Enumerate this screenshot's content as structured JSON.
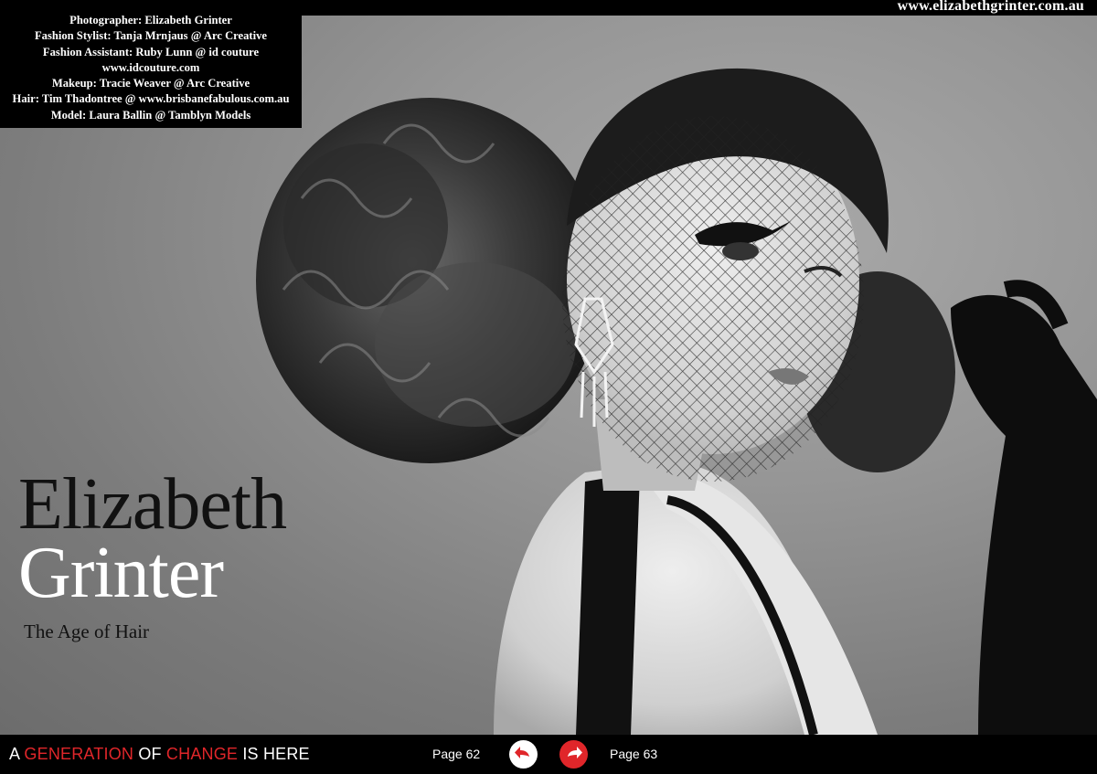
{
  "header": {
    "url": "www.elizabethgrinter.com.au"
  },
  "credits": [
    "Photographer: Elizabeth Grinter",
    "Fashion Stylist: Tanja Mrnjaus @ Arc Creative",
    "Fashion Assistant: Ruby Lunn @ id couture",
    "www.idcouture.com",
    "Makeup: Tracie Weaver @ Arc Creative",
    "Hair: Tim  Thadontree @ www.brisbanefabulous.com.au",
    "Model: Laura Ballin @ Tamblyn Models"
  ],
  "headline": {
    "first": "Elizabeth",
    "last": "Grinter",
    "subtitle": "The Age of Hair"
  },
  "footer": {
    "slogan": [
      "A",
      "GENERATION",
      "OF",
      "CHANGE",
      "IS HERE"
    ],
    "prev_page": "Page 62",
    "next_page": "Page 63",
    "prev_icon": "arrow-left-icon",
    "next_icon": "arrow-right-icon"
  },
  "colors": {
    "accent": "#e0262a",
    "bar": "#000000"
  }
}
